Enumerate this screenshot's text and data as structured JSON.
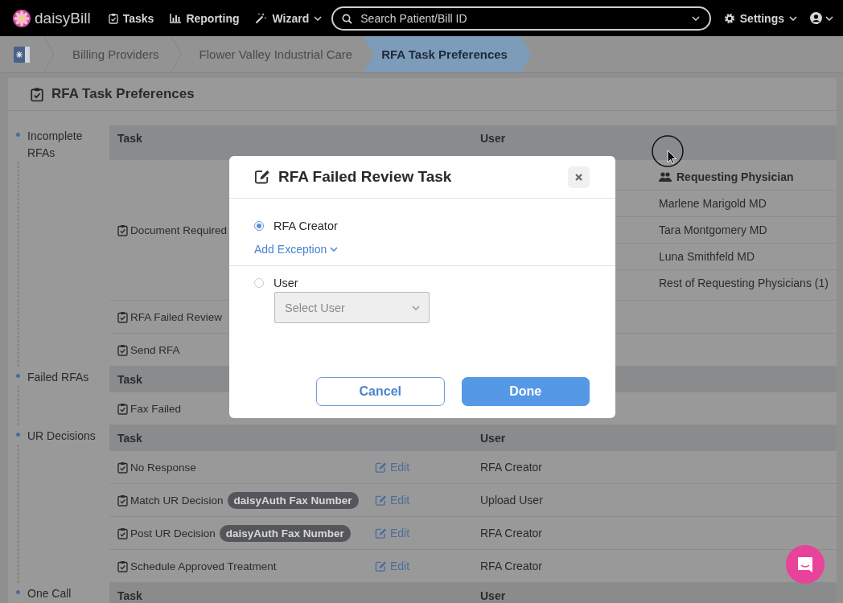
{
  "navbar": {
    "logo": "daisyBill",
    "items": [
      {
        "label": "Tasks",
        "dropdown": false
      },
      {
        "label": "Reporting",
        "dropdown": false
      },
      {
        "label": "Wizard",
        "dropdown": true
      }
    ],
    "search": {
      "placeholder": "Search Patient/Bill ID"
    },
    "settings": {
      "label": "Settings",
      "dropdown": true
    }
  },
  "breadcrumbs": [
    {
      "label": "Billing Providers",
      "selected": false
    },
    {
      "label": "Flower Valley Industrial Care",
      "selected": false
    },
    {
      "label": "RFA Task Preferences",
      "selected": true
    }
  ],
  "panel": {
    "title": "RFA Task Preferences",
    "sections": [
      {
        "name": "Incomplete RFAs",
        "columns": [
          "Task",
          "User"
        ],
        "rows": [
          {
            "task": "Document Required",
            "exceptions": {
              "heading": "Requesting Physician",
              "items": [
                "Marlene Marigold MD",
                "Tara Montgomery MD",
                "Luna Smithfeld MD",
                "Rest of Requesting Physicians (1)"
              ]
            }
          },
          {
            "task": "RFA Failed Review"
          },
          {
            "task": "Send RFA"
          }
        ]
      },
      {
        "name": "Failed RFAs",
        "columns": [
          "Task"
        ],
        "rows": [
          {
            "task": "Fax Failed"
          }
        ]
      },
      {
        "name": "UR Decisions",
        "columns": [
          "Task",
          "User"
        ],
        "rows": [
          {
            "task": "No Response",
            "edit": "Edit",
            "user": "RFA Creator"
          },
          {
            "task": "Match UR Decision",
            "tag": "daisyAuth Fax Number",
            "edit": "Edit",
            "user": "Upload User"
          },
          {
            "task": "Post UR Decision",
            "tag": "daisyAuth Fax Number",
            "edit": "Edit",
            "user": "RFA Creator"
          },
          {
            "task": "Schedule Approved Treatment",
            "edit": "Edit",
            "user": "RFA Creator"
          }
        ]
      },
      {
        "name": "One Call",
        "columns": [
          "Task",
          "User"
        ]
      }
    ]
  },
  "modal": {
    "title": "RFA Failed Review Task",
    "options": [
      {
        "label": "RFA Creator",
        "selected": true
      },
      {
        "label": "User",
        "selected": false
      }
    ],
    "add_exception": "Add Exception",
    "select": {
      "placeholder": "Select User",
      "disabled": true
    },
    "buttons": [
      "Cancel",
      "Done"
    ]
  }
}
